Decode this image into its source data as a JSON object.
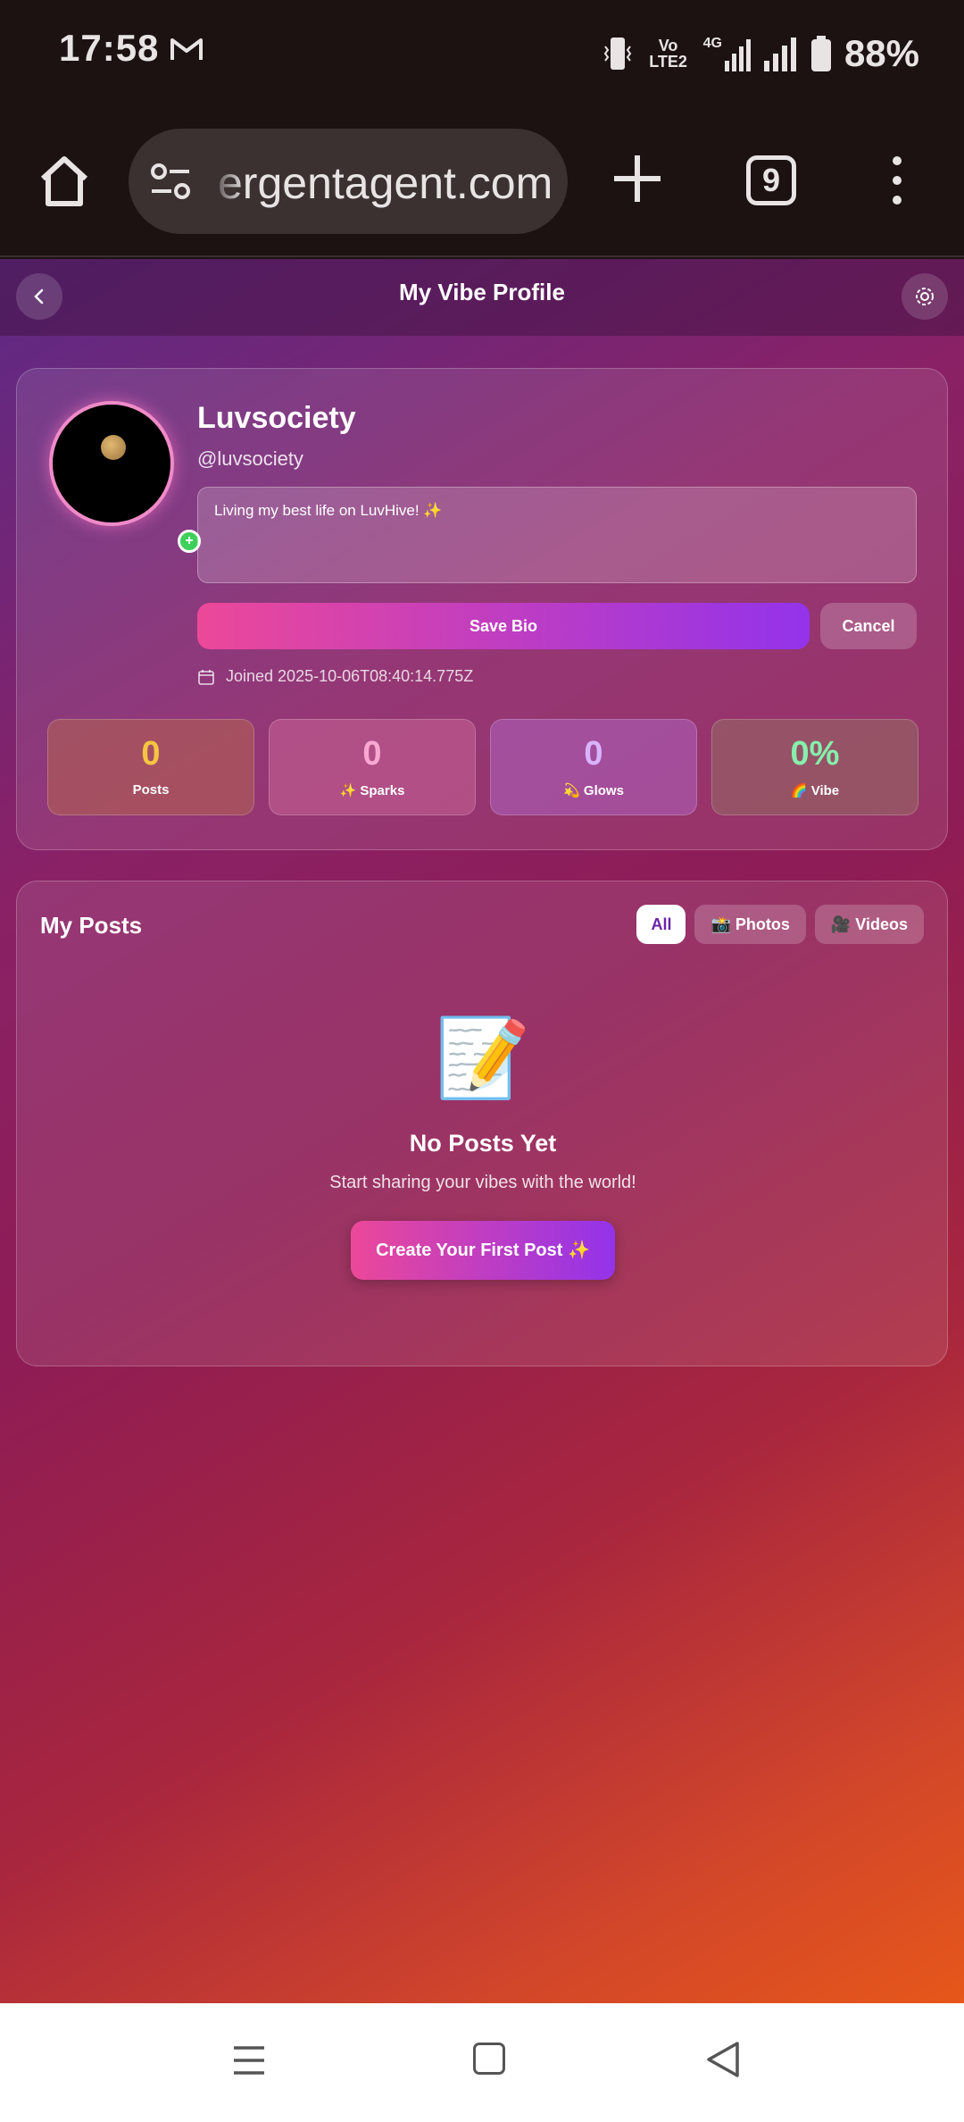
{
  "status_bar": {
    "time": "17:58",
    "mail_icon": "gmail-icon",
    "volte": "Vo LTE2",
    "network": "4G",
    "battery": "88%"
  },
  "browser": {
    "url": "ergentagent.com",
    "tab_count": "9"
  },
  "header": {
    "title": "My Vibe Profile"
  },
  "profile": {
    "name": "Luvsociety",
    "handle": "@luvsociety",
    "bio": "Living my best life on LuvHive! ✨",
    "save_bio_label": "Save Bio",
    "cancel_label": "Cancel",
    "joined": "Joined 2025-10-06T08:40:14.775Z"
  },
  "stats": [
    {
      "value": "0",
      "label": "Posts",
      "color": "#f5c542"
    },
    {
      "value": "0",
      "label": "✨ Sparks",
      "color": "#f9a8d4"
    },
    {
      "value": "0",
      "label": "💫 Glows",
      "color": "#c4b5fd"
    },
    {
      "value": "0%",
      "label": "🌈 Vibe",
      "color": "#86efac"
    }
  ],
  "posts": {
    "title": "My Posts",
    "filters": [
      "All",
      "📸 Photos",
      "🎥 Videos"
    ],
    "active_filter": "All",
    "empty_icon": "📝",
    "empty_title": "No Posts Yet",
    "empty_subtitle": "Start sharing your vibes with the world!",
    "create_label": "Create Your First Post ✨"
  },
  "colors": {
    "accent_pink": "#ec4899",
    "accent_purple": "#9333ea"
  }
}
